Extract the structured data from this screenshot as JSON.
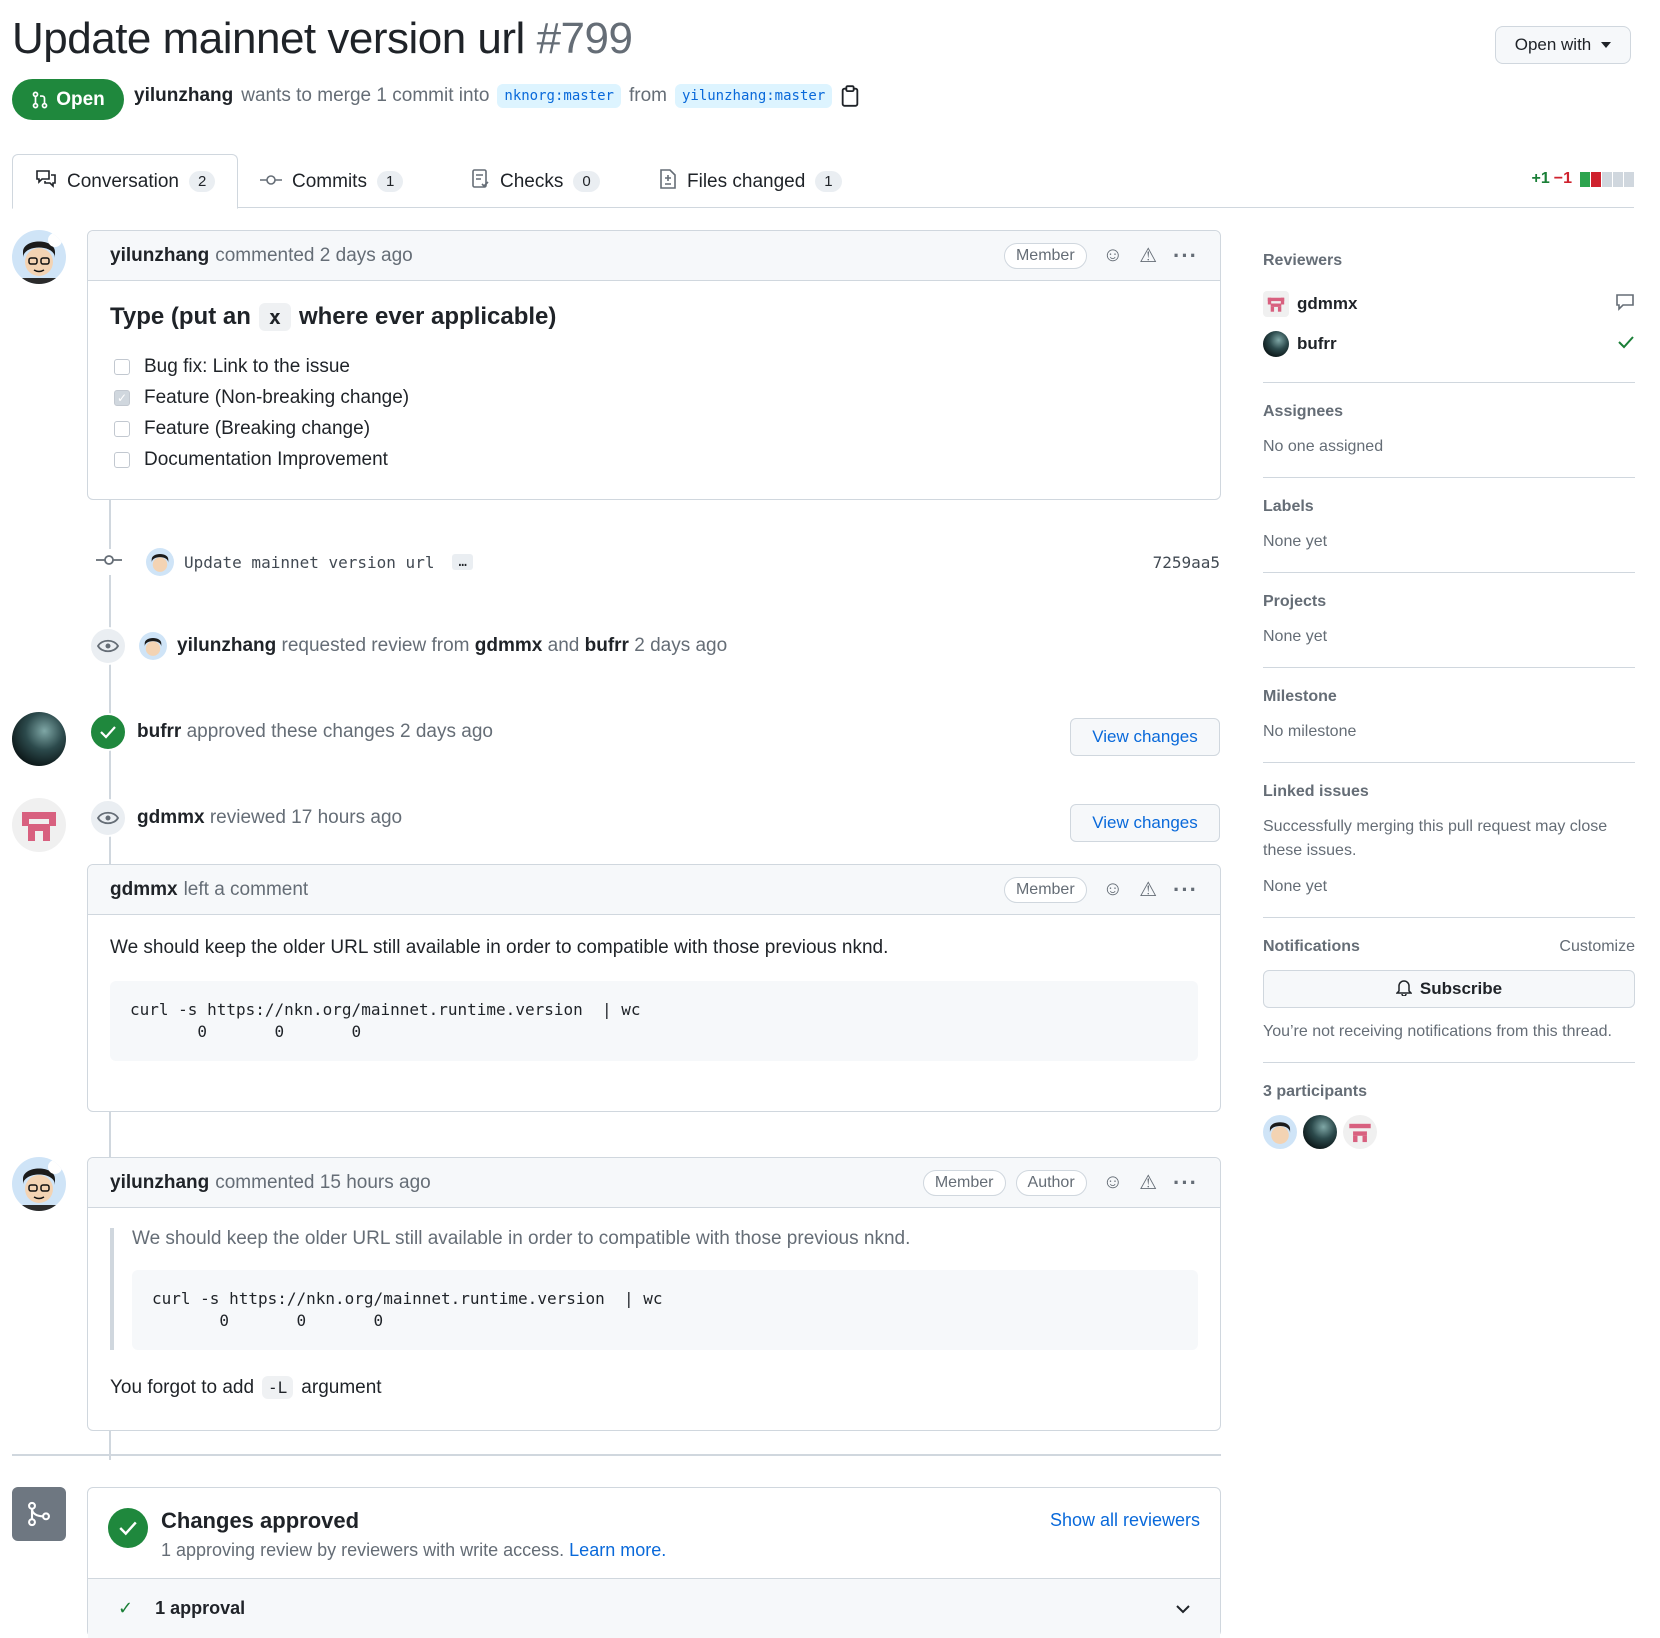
{
  "header": {
    "title": "Update mainnet version url",
    "number": "#799",
    "open_with": "Open with",
    "state": "Open",
    "author": "yilunzhang",
    "merge_text": "wants to merge 1 commit into",
    "base_branch": "nknorg:master",
    "from": "from",
    "head_branch": "yilunzhang:master"
  },
  "tabs": [
    {
      "label": "Conversation",
      "count": "2"
    },
    {
      "label": "Commits",
      "count": "1"
    },
    {
      "label": "Checks",
      "count": "0"
    },
    {
      "label": "Files changed",
      "count": "1"
    }
  ],
  "diffstat": {
    "additions": "+1",
    "deletions": "−1"
  },
  "comment1": {
    "author": "yilunzhang",
    "action": "commented 2 days ago",
    "badge": "Member",
    "heading_pre": "Type (put an",
    "heading_code": "x",
    "heading_post": "where ever applicable)",
    "tasks": [
      {
        "label": "Bug fix: Link to the issue",
        "checked": false
      },
      {
        "label": "Feature (Non-breaking change)",
        "checked": true
      },
      {
        "label": "Feature (Breaking change)",
        "checked": false
      },
      {
        "label": "Documentation Improvement",
        "checked": false
      }
    ]
  },
  "commit": {
    "message": "Update mainnet version url",
    "ellipsis": "…",
    "sha": "7259aa5"
  },
  "review_request": {
    "actor": "yilunzhang",
    "text1": "requested review from",
    "r1": "gdmmx",
    "and": "and",
    "r2": "bufrr",
    "time": "2 days ago"
  },
  "approval": {
    "actor": "bufrr",
    "text": "approved these changes 2 days ago",
    "button": "View changes"
  },
  "review": {
    "actor": "gdmmx",
    "text": "reviewed 17 hours ago",
    "button": "View changes"
  },
  "comment2": {
    "author": "gdmmx",
    "action": "left a comment",
    "badge": "Member",
    "text": "We should keep the older URL still available in order to compatible with those previous nknd.",
    "code": "curl -s https://nkn.org/mainnet.runtime.version  | wc\n       0       0       0"
  },
  "comment3": {
    "author": "yilunzhang",
    "action": "commented 15 hours ago",
    "badge1": "Member",
    "badge2": "Author",
    "quote": "We should keep the older URL still available in order to compatible with those previous nknd.",
    "code": "curl -s https://nkn.org/mainnet.runtime.version  | wc\n       0       0       0",
    "reply_pre": "You forgot to add",
    "reply_code": "-L",
    "reply_post": "argument"
  },
  "merge": {
    "title": "Changes approved",
    "sub": "1 approving review by reviewers with write access.",
    "learn": "Learn more.",
    "show_all": "Show all reviewers",
    "approvals": "1 approval"
  },
  "sidebar": {
    "reviewers_h": "Reviewers",
    "reviewers": [
      "gdmmx",
      "bufrr"
    ],
    "assignees_h": "Assignees",
    "assignees": "No one assigned",
    "labels_h": "Labels",
    "labels": "None yet",
    "projects_h": "Projects",
    "projects": "None yet",
    "milestone_h": "Milestone",
    "milestone": "No milestone",
    "linked_h": "Linked issues",
    "linked_text": "Successfully merging this pull request may close these issues.",
    "linked": "None yet",
    "notif_h": "Notifications",
    "customize": "Customize",
    "subscribe": "Subscribe",
    "notif_text": "You’re not receiving notifications from this thread.",
    "participants_h": "3 participants"
  },
  "colors": {
    "accent": "#0969da",
    "open_green": "#1f883d",
    "border": "#d0d7de"
  }
}
